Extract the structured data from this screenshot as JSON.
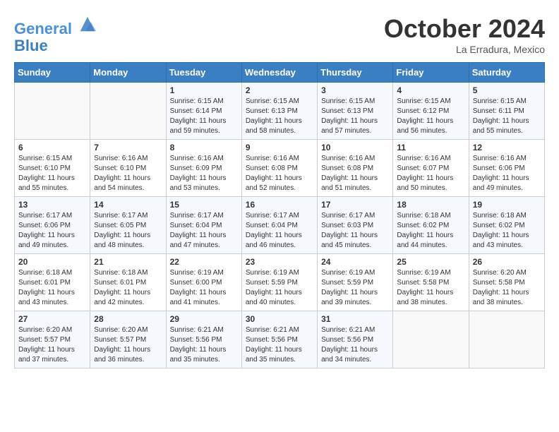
{
  "header": {
    "logo_line1": "General",
    "logo_line2": "Blue",
    "month": "October 2024",
    "location": "La Erradura, Mexico"
  },
  "weekdays": [
    "Sunday",
    "Monday",
    "Tuesday",
    "Wednesday",
    "Thursday",
    "Friday",
    "Saturday"
  ],
  "weeks": [
    [
      {
        "day": "",
        "info": ""
      },
      {
        "day": "",
        "info": ""
      },
      {
        "day": "1",
        "info": "Sunrise: 6:15 AM\nSunset: 6:14 PM\nDaylight: 11 hours and 59 minutes."
      },
      {
        "day": "2",
        "info": "Sunrise: 6:15 AM\nSunset: 6:13 PM\nDaylight: 11 hours and 58 minutes."
      },
      {
        "day": "3",
        "info": "Sunrise: 6:15 AM\nSunset: 6:13 PM\nDaylight: 11 hours and 57 minutes."
      },
      {
        "day": "4",
        "info": "Sunrise: 6:15 AM\nSunset: 6:12 PM\nDaylight: 11 hours and 56 minutes."
      },
      {
        "day": "5",
        "info": "Sunrise: 6:15 AM\nSunset: 6:11 PM\nDaylight: 11 hours and 55 minutes."
      }
    ],
    [
      {
        "day": "6",
        "info": "Sunrise: 6:15 AM\nSunset: 6:10 PM\nDaylight: 11 hours and 55 minutes."
      },
      {
        "day": "7",
        "info": "Sunrise: 6:16 AM\nSunset: 6:10 PM\nDaylight: 11 hours and 54 minutes."
      },
      {
        "day": "8",
        "info": "Sunrise: 6:16 AM\nSunset: 6:09 PM\nDaylight: 11 hours and 53 minutes."
      },
      {
        "day": "9",
        "info": "Sunrise: 6:16 AM\nSunset: 6:08 PM\nDaylight: 11 hours and 52 minutes."
      },
      {
        "day": "10",
        "info": "Sunrise: 6:16 AM\nSunset: 6:08 PM\nDaylight: 11 hours and 51 minutes."
      },
      {
        "day": "11",
        "info": "Sunrise: 6:16 AM\nSunset: 6:07 PM\nDaylight: 11 hours and 50 minutes."
      },
      {
        "day": "12",
        "info": "Sunrise: 6:16 AM\nSunset: 6:06 PM\nDaylight: 11 hours and 49 minutes."
      }
    ],
    [
      {
        "day": "13",
        "info": "Sunrise: 6:17 AM\nSunset: 6:06 PM\nDaylight: 11 hours and 49 minutes."
      },
      {
        "day": "14",
        "info": "Sunrise: 6:17 AM\nSunset: 6:05 PM\nDaylight: 11 hours and 48 minutes."
      },
      {
        "day": "15",
        "info": "Sunrise: 6:17 AM\nSunset: 6:04 PM\nDaylight: 11 hours and 47 minutes."
      },
      {
        "day": "16",
        "info": "Sunrise: 6:17 AM\nSunset: 6:04 PM\nDaylight: 11 hours and 46 minutes."
      },
      {
        "day": "17",
        "info": "Sunrise: 6:17 AM\nSunset: 6:03 PM\nDaylight: 11 hours and 45 minutes."
      },
      {
        "day": "18",
        "info": "Sunrise: 6:18 AM\nSunset: 6:02 PM\nDaylight: 11 hours and 44 minutes."
      },
      {
        "day": "19",
        "info": "Sunrise: 6:18 AM\nSunset: 6:02 PM\nDaylight: 11 hours and 43 minutes."
      }
    ],
    [
      {
        "day": "20",
        "info": "Sunrise: 6:18 AM\nSunset: 6:01 PM\nDaylight: 11 hours and 43 minutes."
      },
      {
        "day": "21",
        "info": "Sunrise: 6:18 AM\nSunset: 6:01 PM\nDaylight: 11 hours and 42 minutes."
      },
      {
        "day": "22",
        "info": "Sunrise: 6:19 AM\nSunset: 6:00 PM\nDaylight: 11 hours and 41 minutes."
      },
      {
        "day": "23",
        "info": "Sunrise: 6:19 AM\nSunset: 5:59 PM\nDaylight: 11 hours and 40 minutes."
      },
      {
        "day": "24",
        "info": "Sunrise: 6:19 AM\nSunset: 5:59 PM\nDaylight: 11 hours and 39 minutes."
      },
      {
        "day": "25",
        "info": "Sunrise: 6:19 AM\nSunset: 5:58 PM\nDaylight: 11 hours and 38 minutes."
      },
      {
        "day": "26",
        "info": "Sunrise: 6:20 AM\nSunset: 5:58 PM\nDaylight: 11 hours and 38 minutes."
      }
    ],
    [
      {
        "day": "27",
        "info": "Sunrise: 6:20 AM\nSunset: 5:57 PM\nDaylight: 11 hours and 37 minutes."
      },
      {
        "day": "28",
        "info": "Sunrise: 6:20 AM\nSunset: 5:57 PM\nDaylight: 11 hours and 36 minutes."
      },
      {
        "day": "29",
        "info": "Sunrise: 6:21 AM\nSunset: 5:56 PM\nDaylight: 11 hours and 35 minutes."
      },
      {
        "day": "30",
        "info": "Sunrise: 6:21 AM\nSunset: 5:56 PM\nDaylight: 11 hours and 35 minutes."
      },
      {
        "day": "31",
        "info": "Sunrise: 6:21 AM\nSunset: 5:56 PM\nDaylight: 11 hours and 34 minutes."
      },
      {
        "day": "",
        "info": ""
      },
      {
        "day": "",
        "info": ""
      }
    ]
  ]
}
